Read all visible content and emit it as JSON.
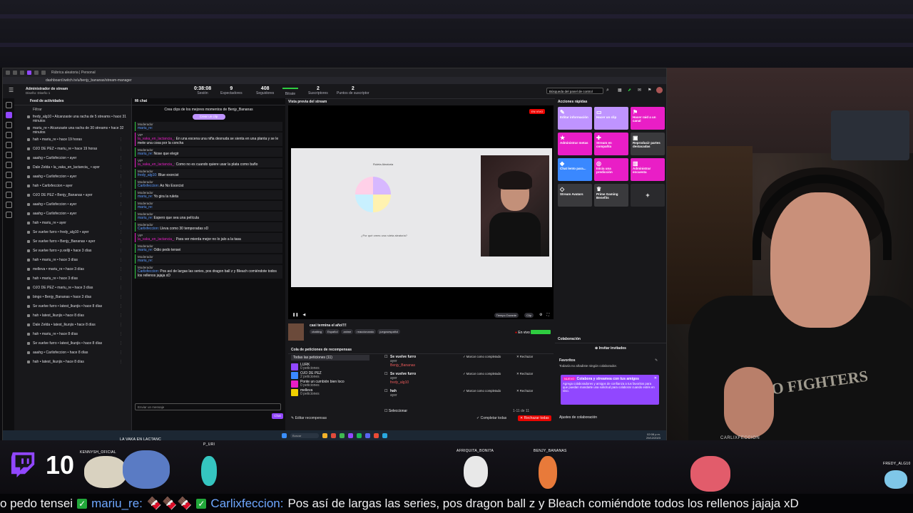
{
  "browser": {
    "active_tab": "Rúbrica aleatoria | Personal",
    "url": "dashboard.twitch.tv/u/benjy_bananas/stream-manager"
  },
  "header": {
    "title": "Administrador de stream",
    "subtitle": "Diseño: Diseño 1",
    "stats": [
      {
        "value": "0:38:08",
        "label": "Sesión"
      },
      {
        "value": "9",
        "label": "Espectadores"
      },
      {
        "value": "408",
        "label": "Seguidores"
      },
      {
        "value": "",
        "label": "Bitrate"
      },
      {
        "value": "2",
        "label": "Suscriptores"
      },
      {
        "value": "2",
        "label": "Puntos de suscriptor"
      }
    ],
    "search_placeholder": "Búsqueda del panel de control"
  },
  "feed": {
    "title": "Feed de actividades",
    "filter": "Filtrar",
    "items": [
      "fredy_alg10 • Alcanzaste una racha de 5 streams • hace 31 minutos",
      "mariu_re • Alcanzaste una racha de 30 streams • hace 32 minutos",
      "hah • mariu_re • hace 19 horas",
      "OJO DE PEZ • mariu_re • hace 19 horas",
      "aaahg • Carlixfeccion • ayer",
      "Dale Zelda • la_vaka_en_lactancia_ • ayer",
      "aaahg • Carlixfeccion • ayer",
      "hah • Carlixfeccion • ayer",
      "OJO DE PEZ • Benjy_Bananas • ayer",
      "aaahg • Carlixfeccion • ayer",
      "aaahg • Carlixfeccion • ayer",
      "hah • mariu_re • ayer",
      "Se vuelve furro • fredy_alg10 • ayer",
      "Se vuelve furro • Benjy_Bananas • ayer",
      "Se vuelve furro • p.xellji • hace 3 días",
      "hah • mariu_re • hace 3 días",
      "melleva • mariu_re • hace 3 días",
      "hah • mariu_re • hace 3 días",
      "OJO DE PEZ • mariu_re • hace 3 días",
      "bingo • Benjy_Bananas • hace 3 días",
      "Se vuelve furro • latest_lkunjis • hace 8 días",
      "hah • latest_lkunjis • hace 8 días",
      "Dale Zelda • latest_lkunjis • hace 8 días",
      "hah • mariu_re • hace 8 días",
      "Se vuelve furro • latest_lkunjis • hace 8 días",
      "aaahg • Carlixfeccion • hace 8 días",
      "hah • latest_lkunjis • hace 8 días"
    ]
  },
  "chat": {
    "title": "Mi chat",
    "clip_prompt": "Crea clips de los mejores momentos de Benjy_Bananas",
    "clip_button": "Crear un clip",
    "messages": [
      {
        "role": "Moderador",
        "user": "mariu_re:",
        "text": "",
        "vip": false
      },
      {
        "role": "VIP",
        "user": "la_vaka_en_lactancia_:",
        "text": "En una escena una niña desnuda se sienta en una planta y se le mete una cosa por la concha",
        "vip": true
      },
      {
        "role": "Moderador",
        "user": "mariu_re:",
        "text": "Nose que elegir",
        "vip": false
      },
      {
        "role": "VIP",
        "user": "la_vaka_en_lactancia_:",
        "text": "Como no es cuando quiere usar la plata como baño",
        "vip": true
      },
      {
        "role": "Moderador",
        "user": "fredy_alg10:",
        "text": "Blue exorcist",
        "vip": false
      },
      {
        "role": "Moderador",
        "user": "Carlixfeccion:",
        "text": "Ao No Exorcist",
        "vip": false
      },
      {
        "role": "Moderador",
        "user": "mariu_re:",
        "text": "Yo gira la ruleta",
        "vip": false
      },
      {
        "role": "Moderador",
        "user": "mariu_re:",
        "text": "",
        "vip": false
      },
      {
        "role": "Moderador",
        "user": "mariu_re:",
        "text": "Espero que sea una película",
        "vip": false
      },
      {
        "role": "Moderador",
        "user": "Carlixfeccion:",
        "text": "Lleva como 30 temporadas xD",
        "vip": false
      },
      {
        "role": "VIP",
        "user": "la_vaka_en_lactancia_:",
        "text": "Para ver mierda mejor no lo jalo a la tasa",
        "vip": true
      },
      {
        "role": "Moderador",
        "user": "mariu_re:",
        "text": "Odio pedo tensei",
        "vip": false
      },
      {
        "role": "Moderador",
        "user": "mariu_re:",
        "text": "",
        "vip": false
      },
      {
        "role": "Moderador",
        "user": "Carlixfeccion:",
        "text": "Pos así de largas las series, pos dragon ball z y Bleach comiéndote todos los rellenos jajaja xD",
        "vip": false
      }
    ],
    "input_placeholder": "Enviar un mensaje",
    "send_button": "Chat"
  },
  "preview": {
    "title": "Vista previa del stream",
    "live": "EN VIVO",
    "wheel_title": "Ruleta Aleatoria",
    "wheel_question": "¿Por qué crees una ruleta aleatoria?",
    "clip_label": "Clip",
    "quality": "Tiempo Durante"
  },
  "stream_info": {
    "title": "casi termina el año!!!!",
    "tags": [
      "chatting",
      "Español",
      "anime",
      "reaccionando",
      "juegosespañol"
    ],
    "status": "En vivo"
  },
  "rewards": {
    "title": "Cola de peticiones de recompensas",
    "filter_all": "Todas las peticiones (11)",
    "items": [
      {
        "name": "LURK",
        "count": "0 peticiones"
      },
      {
        "name": "OJO DE PEZ",
        "count": "2 peticiones"
      },
      {
        "name": "Ponte un cumbión bien loco",
        "count": "0 peticiones"
      },
      {
        "name": "melleva",
        "count": "0 peticiones"
      }
    ],
    "requests": [
      {
        "title": "Se vuelve furro",
        "time": "ayer",
        "user": "Benjy_Bananas"
      },
      {
        "title": "Se vuelve furro",
        "time": "ayer",
        "user": "fredy_alg10"
      },
      {
        "title": "hah",
        "time": "ayer",
        "user": ""
      }
    ],
    "complete": "Marcar como completado",
    "reject": "Rechazar",
    "select": "Seleccionar",
    "range": "1-11 de 11",
    "complete_all": "Completar todas",
    "reject_all": "Rechazar todas",
    "edit": "Editar recompensas"
  },
  "quick_actions": {
    "title": "Acciones rápidas",
    "items": [
      {
        "label": "Editar información",
        "color": "#bf94ff",
        "icon": "✎"
      },
      {
        "label": "Hacer un clip",
        "color": "#bf94ff",
        "icon": "▭"
      },
      {
        "label": "Hacer raid a un canal",
        "color": "#e91ec6",
        "icon": "⚑"
      },
      {
        "label": "Administrar metas",
        "color": "#e91ec6",
        "icon": "★"
      },
      {
        "label": "Stream en compañía",
        "color": "#e91ec6",
        "icon": "✚"
      },
      {
        "label": "Reproducir partes destacadas",
        "color": "#3a3a3d",
        "icon": "▣"
      },
      {
        "label": "Chat lento para...",
        "color": "#3a88ff",
        "icon": "◆"
      },
      {
        "label": "Inicia una predicción",
        "color": "#e91ec6",
        "icon": "◎"
      },
      {
        "label": "Administrar encuesta",
        "color": "#e91ec6",
        "icon": "▥"
      },
      {
        "label": "Stream Avatars",
        "color": "#3a3a3d",
        "icon": "◇"
      },
      {
        "label": "Prime Gaming Benefits",
        "color": "#3a3a3d",
        "icon": "♛"
      },
      {
        "label": "+",
        "color": "#2a2a2d",
        "icon": ""
      }
    ]
  },
  "collab": {
    "title": "Colaboración",
    "invite": "Invitar invitados",
    "favorites": "Favoritos",
    "favorites_empty": "Todavía no añadiste ningún colaborador.",
    "promo_badge": "NUEVO",
    "promo_title": "Colabora y streamea con tus amigos",
    "promo_text": "Agrega colaboradores y amigos de confianza a tus favoritos para que puedan mandarte una solicitud para colaborar cuando estés en vivo.",
    "settings": "Ajustes de colaboración"
  },
  "taskbar": {
    "search": "Buscar",
    "time": "02:08 p.m.",
    "date": "29/12/2023"
  },
  "webcam": {
    "label": "CARLIXFECCION",
    "shirt_text": "FOO FIGHTERS"
  },
  "overlay": {
    "viewer_count": "10",
    "players": [
      "KENNYSH_OFICIAL",
      "LA VAKA EN LACTANC",
      "P_URI",
      "AFRIQUITA_BONITA",
      "BENJY_BANANAS",
      "FREDY_ALG10"
    ],
    "ticker": [
      {
        "type": "text",
        "value": "o pedo tensei"
      },
      {
        "type": "user",
        "value": "mariu_re:"
      },
      {
        "type": "text",
        "value": "🍫🍫🍫"
      },
      {
        "type": "user",
        "value": "Carlixfeccion:"
      },
      {
        "type": "text",
        "value": "Pos así de largas las series, pos dragon ball z y Bleach comiéndote todos los rellenos jajaja xD"
      }
    ]
  },
  "colors": {
    "twitch_purple": "#9147ff",
    "mod_green": "#2ecc40",
    "vip_pink": "#e91ec6",
    "live_red": "#eb0400"
  }
}
